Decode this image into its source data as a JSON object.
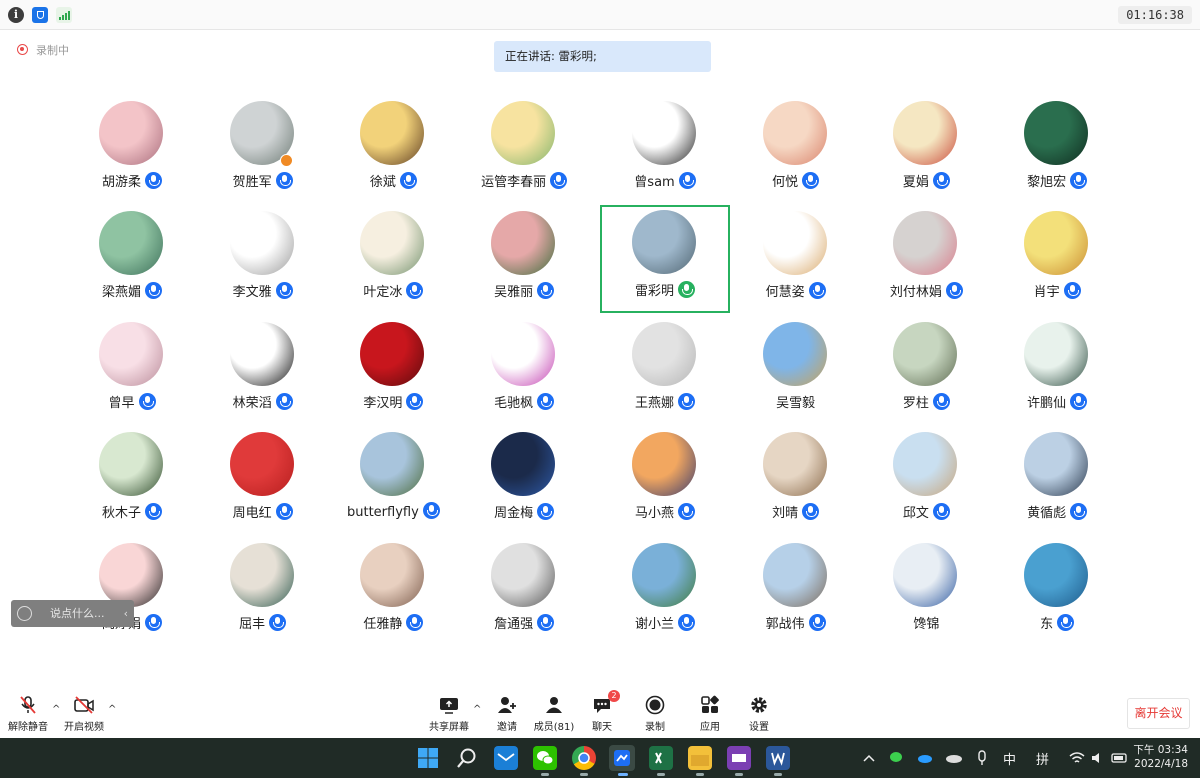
{
  "topbar": {
    "info_glyph": "i",
    "timer": "01:16:38"
  },
  "recording": {
    "label": "录制中"
  },
  "speaker_banner": {
    "text": "正在讲话: 雷彩明;"
  },
  "participants": [
    {
      "name": "胡游柔",
      "avatar": [
        "#f3c4c8",
        "#a76b7a"
      ]
    },
    {
      "name": "贺胜军",
      "avatar": [
        "#cfd3d4",
        "#6d7a74"
      ],
      "host": true
    },
    {
      "name": "徐斌",
      "avatar": [
        "#f2d27a",
        "#5b3a20"
      ]
    },
    {
      "name": "运管李春丽",
      "avatar": [
        "#f7e3a0",
        "#7fb36a"
      ]
    },
    {
      "name": "曾sam",
      "avatar": [
        "#ffffff",
        "#222222"
      ]
    },
    {
      "name": "何悦",
      "avatar": [
        "#f6d8c4",
        "#d9826a"
      ]
    },
    {
      "name": "夏娟",
      "avatar": [
        "#f5e7c2",
        "#c94a3a"
      ]
    },
    {
      "name": "黎旭宏",
      "avatar": [
        "#2a6e4e",
        "#0f2b1f"
      ]
    },
    {
      "name": "梁燕媚",
      "avatar": [
        "#8fc3a2",
        "#3b6e58"
      ]
    },
    {
      "name": "李文雅",
      "avatar": [
        "#ffffff",
        "#9a9a9a"
      ]
    },
    {
      "name": "叶定冰",
      "avatar": [
        "#f6efe0",
        "#6f8f6a"
      ]
    },
    {
      "name": "吴雅丽",
      "avatar": [
        "#e5a8a8",
        "#3c6b3a"
      ]
    },
    {
      "name": "雷彩明",
      "avatar": [
        "#9fb8cc",
        "#4f6470"
      ],
      "active": true
    },
    {
      "name": "何慧姿",
      "avatar": [
        "#ffffff",
        "#d9a96b"
      ]
    },
    {
      "name": "刘付林娟",
      "avatar": [
        "#d6d2d0",
        "#d97b8a"
      ]
    },
    {
      "name": "肖宇",
      "avatar": [
        "#f3e07a",
        "#c98a2f"
      ]
    },
    {
      "name": "曾早",
      "avatar": [
        "#f8dfe6",
        "#b88a98"
      ]
    },
    {
      "name": "林荣滔",
      "avatar": [
        "#ffffff",
        "#111111"
      ]
    },
    {
      "name": "李汉明",
      "avatar": [
        "#c8161d",
        "#5a0a0c"
      ]
    },
    {
      "name": "毛驰枫",
      "avatar": [
        "#ffffff",
        "#c23fb0"
      ]
    },
    {
      "name": "王燕娜",
      "avatar": [
        "#e2e2e2",
        "#b4b4b4"
      ],
      "mic_plain": true
    },
    {
      "name": "吴雪毅",
      "avatar": [
        "#7fb5e8",
        "#c7a25a"
      ],
      "no_mic": true
    },
    {
      "name": "罗柱",
      "avatar": [
        "#c7d6c0",
        "#5d6a50"
      ]
    },
    {
      "name": "许鹏仙",
      "avatar": [
        "#e8f2ec",
        "#2a4a3e"
      ]
    },
    {
      "name": "秋木子",
      "avatar": [
        "#d8e8d0",
        "#2d4a2a"
      ]
    },
    {
      "name": "周电红",
      "avatar": [
        "#e03a3a",
        "#b51e1e"
      ]
    },
    {
      "name": "butterflyfly",
      "avatar": [
        "#a8c4dc",
        "#4b6a3a"
      ]
    },
    {
      "name": "周金梅",
      "avatar": [
        "#1b2a4a",
        "#2e5aa8"
      ]
    },
    {
      "name": "马小燕",
      "avatar": [
        "#f2a760",
        "#3a3c6e"
      ]
    },
    {
      "name": "刘晴",
      "avatar": [
        "#e6d6c4",
        "#8a6a4a"
      ]
    },
    {
      "name": "邱文",
      "avatar": [
        "#c9dff0",
        "#c8a47a"
      ]
    },
    {
      "name": "黄循彪",
      "avatar": [
        "#bcd0e4",
        "#27364a"
      ]
    },
    {
      "name": "阎婷娟",
      "avatar": [
        "#f9d6d6",
        "#222222"
      ]
    },
    {
      "name": "屈丰",
      "avatar": [
        "#e6e0d6",
        "#2e5a4e"
      ]
    },
    {
      "name": "任雅静",
      "avatar": [
        "#e8d0c0",
        "#7a5a4a"
      ]
    },
    {
      "name": "詹通强",
      "avatar": [
        "#e0e0e0",
        "#555555"
      ]
    },
    {
      "name": "谢小兰",
      "avatar": [
        "#7ab0d8",
        "#3e7a3a"
      ]
    },
    {
      "name": "郭战伟",
      "avatar": [
        "#b6d0e8",
        "#7a6a5a"
      ]
    },
    {
      "name": "馋锦",
      "avatar": [
        "#e8eef4",
        "#2f5aa0"
      ],
      "no_mic": true
    },
    {
      "name": "东",
      "avatar": [
        "#4aa0d0",
        "#1d5a8a"
      ]
    }
  ],
  "chat": {
    "placeholder": "说点什么...",
    "arrow": "‹"
  },
  "toolbar": {
    "unmute": "解除静音",
    "start_video": "开启视频",
    "share_screen": "共享屏幕",
    "invite": "邀请",
    "members": "成员(81)",
    "chat": "聊天",
    "chat_badge": "2",
    "record": "录制",
    "apps": "应用",
    "settings": "设置",
    "leave": "离开会议",
    "caret": "^"
  },
  "taskbar": {
    "ime_lang": "中",
    "ime_mode": "拼",
    "time": "下午 03:34",
    "date": "2022/4/18"
  },
  "colors": {
    "accent_blue": "#1d6ef4",
    "active_green": "#27b15f",
    "leave_red": "#e53935",
    "banner_bg": "#d9e8fb"
  }
}
